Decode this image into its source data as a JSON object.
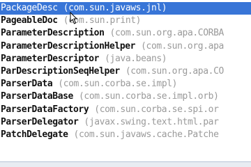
{
  "completion_list": {
    "items": [
      {
        "name": "PackageDesc",
        "package": "(com.sun.javaws.jnl)",
        "selected": true
      },
      {
        "name": "PageableDoc",
        "package": "(com.sun.print)",
        "selected": false
      },
      {
        "name": "ParameterDescription",
        "package": "(com.sun.org.apa.CORBA",
        "selected": false
      },
      {
        "name": "ParameterDescriptionHelper",
        "package": "(com.sun.org.apa",
        "selected": false
      },
      {
        "name": "ParameterDescriptor",
        "package": "(java.beans)",
        "selected": false
      },
      {
        "name": "ParDescriptionSeqHelper",
        "package": "(com.sun.org.apa.CO",
        "selected": false
      },
      {
        "name": "ParserData",
        "package": "(com.sun.corba.se.impl)",
        "selected": false
      },
      {
        "name": "ParserDataBase",
        "package": "(com.sun.corba.se.impl.orb)",
        "selected": false
      },
      {
        "name": "ParserDataFactory",
        "package": "(com.sun.corba.se.spi.or",
        "selected": false
      },
      {
        "name": "ParserDelegator",
        "package": "(javax.swing.text.html.par",
        "selected": false
      },
      {
        "name": "PatchDelegate",
        "package": "(com.sun.javaws.cache.Patche",
        "selected": false
      }
    ]
  },
  "colors": {
    "selection": "#3875d7",
    "class_text": "#111111",
    "package_text": "#9a9a9a"
  }
}
